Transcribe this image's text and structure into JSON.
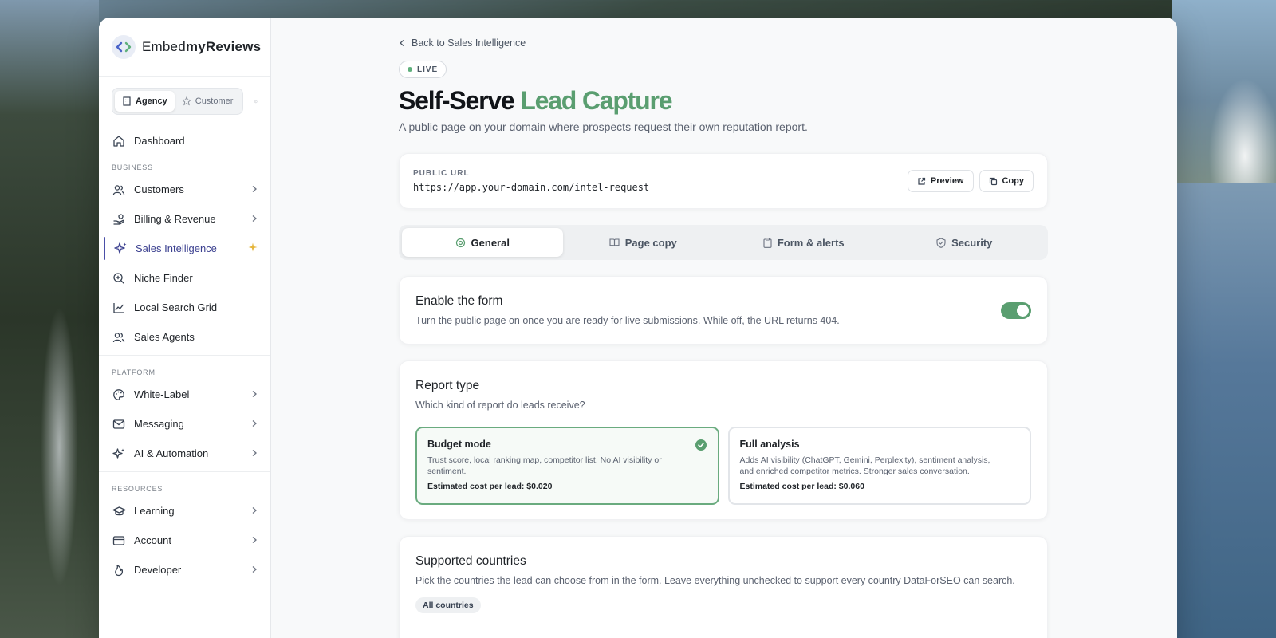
{
  "brand": {
    "name_prefix": "Embed",
    "name_bold": "myReviews"
  },
  "roles": {
    "agency": "Agency",
    "customer": "Customer"
  },
  "sidebar": {
    "dashboard": "Dashboard",
    "sections": {
      "business": "BUSINESS",
      "platform": "PLATFORM",
      "resources": "RESOURCES"
    },
    "business_items": [
      {
        "label": "Customers",
        "icon": "users-icon"
      },
      {
        "label": "Billing & Revenue",
        "icon": "hand-coins-icon"
      },
      {
        "label": "Sales Intelligence",
        "icon": "sparkles-icon",
        "active": true
      },
      {
        "label": "Niche Finder",
        "icon": "zoom-in-icon"
      },
      {
        "label": "Local Search Grid",
        "icon": "line-chart-icon"
      },
      {
        "label": "Sales Agents",
        "icon": "users-icon"
      }
    ],
    "platform_items": [
      {
        "label": "White-Label",
        "icon": "palette-icon"
      },
      {
        "label": "Messaging",
        "icon": "mail-icon"
      },
      {
        "label": "AI & Automation",
        "icon": "sparkles-icon"
      }
    ],
    "resource_items": [
      {
        "label": "Learning",
        "icon": "graduation-cap-icon"
      },
      {
        "label": "Account",
        "icon": "credit-card-icon"
      },
      {
        "label": "Developer",
        "icon": "flame-icon"
      }
    ]
  },
  "header": {
    "back_link": "Back to Sales Intelligence",
    "badge": "LIVE",
    "title_main": "Self-Serve",
    "title_accent": "Lead Capture",
    "subtitle": "A public page on your domain where prospects request their own reputation report."
  },
  "public_url": {
    "label": "PUBLIC URL",
    "value": "https://app.your-domain.com/intel-request",
    "preview_label": "Preview",
    "copy_label": "Copy"
  },
  "tabs": [
    {
      "label": "General",
      "icon": "settings-icon",
      "active": true
    },
    {
      "label": "Page copy",
      "icon": "book-icon"
    },
    {
      "label": "Form & alerts",
      "icon": "clipboard-icon"
    },
    {
      "label": "Security",
      "icon": "shield-icon"
    }
  ],
  "enable_form": {
    "title": "Enable the form",
    "description": "Turn the public page on once you are ready for live submissions. While off, the URL returns 404.",
    "enabled": true
  },
  "report_type": {
    "title": "Report type",
    "description": "Which kind of report do leads receive?",
    "options": [
      {
        "title": "Budget mode",
        "description": "Trust score, local ranking map, competitor list. No AI visibility or sentiment.",
        "cost": "Estimated cost per lead: $0.020",
        "selected": true
      },
      {
        "title": "Full analysis",
        "description": "Adds AI visibility (ChatGPT, Gemini, Perplexity), sentiment analysis, and enriched competitor metrics. Stronger sales conversation.",
        "cost": "Estimated cost per lead: $0.060",
        "selected": false
      }
    ]
  },
  "countries": {
    "title": "Supported countries",
    "description": "Pick the countries the lead can choose from in the form. Leave everything unchecked to support every country DataForSEO can search.",
    "chip": "All countries"
  },
  "colors": {
    "accent_green": "#5a9e70",
    "nav_active": "#3a3f8f",
    "star_gold": "#e5b53a"
  }
}
